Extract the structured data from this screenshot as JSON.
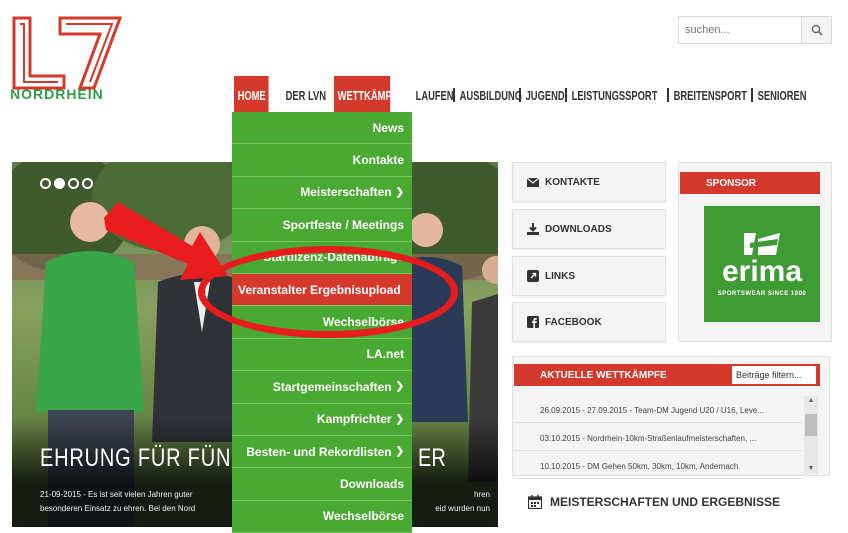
{
  "logo": {
    "text": "NORDRHEIN"
  },
  "search": {
    "placeholder": "suchen..."
  },
  "nav": [
    {
      "label": "HOME",
      "active": true
    },
    {
      "label": "DER LVN",
      "active": false
    },
    {
      "label": "WETTKÄMPFE",
      "active": true
    },
    {
      "label": "LAUFEN",
      "active": false
    },
    {
      "label": "AUSBILDUNG",
      "active": false
    },
    {
      "label": "JUGEND",
      "active": false
    },
    {
      "label": "LEISTUNGSSPORT",
      "active": false
    },
    {
      "label": "BREITENSPORT",
      "active": false
    },
    {
      "label": "SENIOREN",
      "active": false
    }
  ],
  "dropdown": [
    {
      "label": "News",
      "chevron": false
    },
    {
      "label": "Kontakte",
      "chevron": false
    },
    {
      "label": "Meisterschaften",
      "chevron": true
    },
    {
      "label": "Sportfeste / Meetings",
      "chevron": false
    },
    {
      "label": "Startlizenz-Datenabfrage",
      "chevron": false
    },
    {
      "label": "Veranstalter Ergebnisupload",
      "chevron": false,
      "highlight": true
    },
    {
      "label": "Wechselbörse",
      "chevron": false
    },
    {
      "label": "LA.net",
      "chevron": false
    },
    {
      "label": "Startgemeinschaften",
      "chevron": true
    },
    {
      "label": "Kampfrichter",
      "chevron": true
    },
    {
      "label": "Besten- und Rekordlisten",
      "chevron": true
    },
    {
      "label": "Downloads",
      "chevron": false
    },
    {
      "label": "Wechselbörse",
      "chevron": false
    }
  ],
  "slider": {
    "headline": "EHRUNG FÜR FÜNF VER",
    "headline_tail": "ER",
    "text": "21-09-2015 - Es ist seit vielen Jahren guter",
    "text_tail": "hren",
    "text2": "besonderen Einsatz zu ehren. Bei den Nord",
    "text2_tail": "eid wurden nun"
  },
  "side": {
    "kontakte": "KONTAKTE",
    "downloads": "DOWNLOADS",
    "links": "LINKS",
    "facebook": "FACEBOOK"
  },
  "sponsor": {
    "title": "SPONSOR",
    "brand": "erima",
    "tagline": "SPORTSWEAR SINCE 1900"
  },
  "aktuelle": {
    "title": "AKTUELLE WETTKÄMPFE",
    "filter": "Beiträge filtern...",
    "rows": [
      "26.09.2015 - 27.09.2015 - Team-DM Jugend U20 / U16, Leve...",
      "03.10.2015 - Nordrhein-10km-Straßenlaufmeisterschaften, ...",
      "10.10.2015 - DM Gehen 50km, 30km, 10km, Andernach"
    ]
  },
  "meister": {
    "title": "MEISTERSCHAFTEN UND ERGEBNISSE"
  },
  "colors": {
    "red": "#d33a2c",
    "green": "#4aa932",
    "annotation": "#e81c1c"
  }
}
